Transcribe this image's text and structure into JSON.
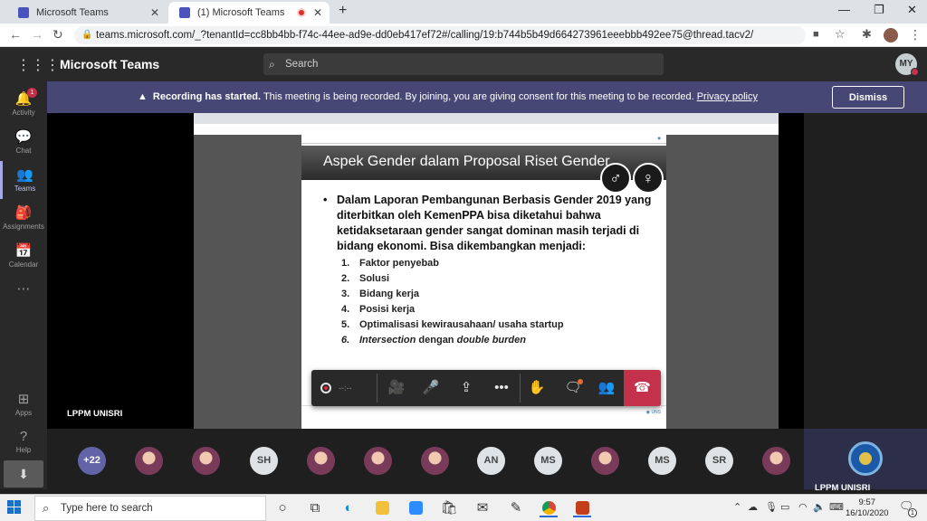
{
  "browser": {
    "tabs": [
      {
        "label": "Microsoft Teams",
        "active": false
      },
      {
        "label": "(1) Microsoft Teams",
        "active": true
      }
    ],
    "new_tab": "+",
    "url": "teams.microsoft.com/_?tenantId=cc8bb4bb-f74c-44ee-ad9e-dd0eb417ef72#/calling/19:b744b5b49d664273961eeebbb492ee75@thread.tacv2/"
  },
  "teams": {
    "app_title": "Microsoft Teams",
    "search_placeholder": "Search",
    "user_initials": "MY"
  },
  "banner": {
    "bold": "Recording has started.",
    "text": " This meeting is being recorded. By joining, you are giving consent for this meeting to be recorded. ",
    "link": "Privacy policy",
    "dismiss_label": "Dismiss"
  },
  "rail": [
    {
      "label": "Activity",
      "icon": "bell-icon",
      "badge": "1"
    },
    {
      "label": "Chat",
      "icon": "chat-icon"
    },
    {
      "label": "Teams",
      "icon": "teams-icon",
      "active": true
    },
    {
      "label": "Assignments",
      "icon": "assignments-icon"
    },
    {
      "label": "Calendar",
      "icon": "calendar-icon"
    },
    {
      "label": "Apps",
      "icon": "apps-icon"
    },
    {
      "label": "Help",
      "icon": "help-icon"
    }
  ],
  "slide": {
    "title": "Aspek Gender dalam Proposal Riset Gender",
    "bullet": "Dalam Laporan Pembangunan Berbasis Gender 2019 yang diterbitkan oleh KemenPPA bisa diketahui bahwa ketidaksetaraan gender sangat dominan masih terjadi di bidang ekonomi. Bisa dikembangkan menjadi:",
    "list": [
      {
        "num": "1.",
        "text": "Faktor penyebab"
      },
      {
        "num": "2.",
        "text": "Solusi"
      },
      {
        "num": "3.",
        "text": "Bidang kerja"
      },
      {
        "num": "4.",
        "text": "Posisi kerja"
      },
      {
        "num": "5.",
        "text": "Optimalisasi kewirausahaan/ usaha startup"
      }
    ],
    "item6": {
      "num": "6.",
      "a": "Intersection",
      "b": " dengan ",
      "c": "double burden"
    }
  },
  "call": {
    "timer": "--:--",
    "presenter_name": "LPPM UNISRI",
    "self_name": "LPPM UNISRI"
  },
  "participants": {
    "more": "+22",
    "initials": [
      "SH",
      "AN",
      "MS",
      "MS",
      "SR"
    ]
  },
  "taskbar": {
    "search_placeholder": "Type here to search",
    "time": "9:57",
    "date": "16/10/2020",
    "notifications": "1"
  }
}
